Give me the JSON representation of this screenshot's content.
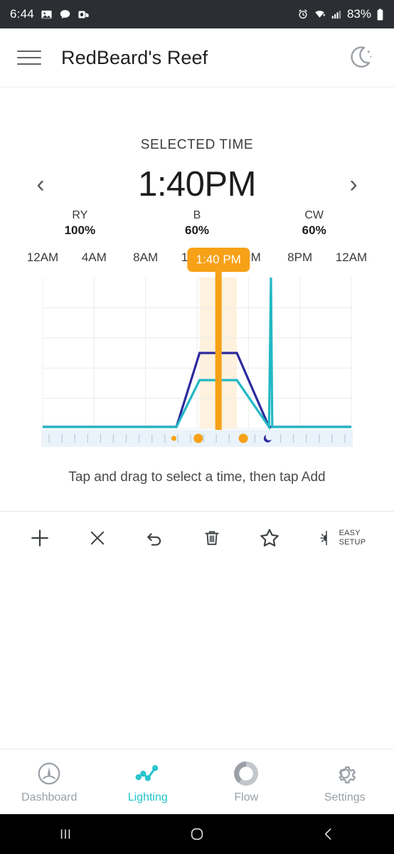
{
  "statusbar": {
    "time": "6:44",
    "battery": "83%",
    "left_icons": [
      "photos-icon",
      "chat-bubble-icon",
      "outlook-icon"
    ],
    "right_icons": [
      "alarm-icon",
      "wifi-icon",
      "signal-icon",
      "battery-icon"
    ]
  },
  "appbar": {
    "menu_icon": "hamburger-menu-icon",
    "title": "RedBeard's Reef",
    "theme_icon": "moon-stars-icon"
  },
  "selected_time": {
    "label": "SELECTED TIME",
    "value": "1:40PM",
    "prev_icon": "chevron-left-icon",
    "next_icon": "chevron-right-icon",
    "channels": [
      {
        "name": "RY",
        "value": "100%"
      },
      {
        "name": "B",
        "value": "60%"
      },
      {
        "name": "CW",
        "value": "60%"
      }
    ]
  },
  "chart_data": {
    "type": "line",
    "title": "",
    "xlabel": "",
    "ylabel": "",
    "xlim": [
      0,
      24
    ],
    "ylim": [
      0,
      100
    ],
    "grid": true,
    "legend_position": "none",
    "tick_labels": [
      "12AM",
      "4AM",
      "8AM",
      "12PM",
      "4PM",
      "8PM",
      "12AM"
    ],
    "tick_values": [
      0,
      4,
      8,
      12,
      16,
      20,
      24
    ],
    "selection": {
      "start": 12.2,
      "end": 15.1,
      "marker": 13.67,
      "label": "1:40 PM"
    },
    "series": [
      {
        "name": "Blue",
        "color": "#2c2a9e",
        "x": [
          0,
          10.4,
          12.2,
          15.1,
          17.6,
          24
        ],
        "values": [
          1,
          1,
          50,
          50,
          1,
          1
        ]
      },
      {
        "name": "Cool White",
        "color": "#22b8c4",
        "x": [
          0,
          10.4,
          12.2,
          15.1,
          17.6,
          17.75,
          17.85,
          24
        ],
        "values": [
          1,
          1,
          32,
          32,
          1,
          100,
          1,
          1
        ]
      }
    ],
    "timeline_markers": [
      {
        "x": 10.2,
        "type": "small-sun",
        "color": "#f6a117"
      },
      {
        "x": 12.1,
        "type": "large-sun",
        "color": "#f6a117"
      },
      {
        "x": 15.6,
        "type": "large-sun",
        "color": "#f6a117"
      },
      {
        "x": 17.5,
        "type": "moon",
        "color": "#2c2a9e"
      }
    ]
  },
  "hint": "Tap and drag to select a time, then tap Add",
  "toolbar": {
    "buttons": [
      {
        "name": "add",
        "icon": "plus-icon",
        "label": ""
      },
      {
        "name": "cancel",
        "icon": "close-x-icon",
        "label": ""
      },
      {
        "name": "undo",
        "icon": "undo-arrow-icon",
        "label": ""
      },
      {
        "name": "delete",
        "icon": "trash-icon",
        "label": ""
      },
      {
        "name": "favorite",
        "icon": "star-icon",
        "label": ""
      },
      {
        "name": "easy-setup",
        "icon": "brightness-half-icon",
        "label_line1": "EASY",
        "label_line2": "SETUP"
      }
    ]
  },
  "bottom_nav": {
    "active": "Lighting",
    "items": [
      {
        "label": "Dashboard",
        "icon": "gauge-icon"
      },
      {
        "label": "Lighting",
        "icon": "line-chart-icon"
      },
      {
        "label": "Flow",
        "icon": "donut-icon"
      },
      {
        "label": "Settings",
        "icon": "gear-icon"
      }
    ]
  },
  "system_nav": {
    "recents_icon": "recents-bars-icon",
    "home_icon": "home-circle-icon",
    "back_icon": "back-chevron-icon"
  },
  "colors": {
    "accent_teal": "#25c3cc",
    "selection_orange": "#f6a117",
    "blue_channel": "#2c2a9e",
    "white_channel": "#22b8c4"
  }
}
